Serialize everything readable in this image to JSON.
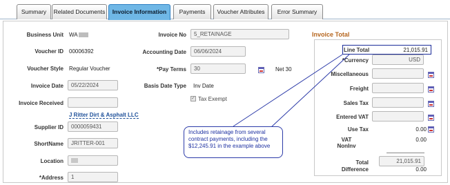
{
  "tabs": [
    {
      "label": "Summary",
      "active": false
    },
    {
      "label": "Related Documents",
      "active": false
    },
    {
      "label": "Invoice Information",
      "active": true
    },
    {
      "label": "Payments",
      "active": false
    },
    {
      "label": "Voucher Attributes",
      "active": false
    },
    {
      "label": "Error Summary",
      "active": false
    }
  ],
  "left": {
    "business_unit": {
      "label": "Business Unit",
      "value": "WA"
    },
    "voucher_id": {
      "label": "Voucher ID",
      "value": "00006392"
    },
    "voucher_style": {
      "label": "Voucher Style",
      "value": "Regular Voucher"
    },
    "invoice_date": {
      "label": "Invoice Date",
      "value": "05/22/2024"
    },
    "invoice_received": {
      "label": "Invoice Received",
      "value": ""
    },
    "supplier_name": "J Ritter Dirt & Asphalt LLC",
    "supplier_id": {
      "label": "Supplier ID",
      "value": "0000059431"
    },
    "short_name": {
      "label": "ShortName",
      "value": "JRITTER-001"
    },
    "location": {
      "label": "Location",
      "value": ""
    },
    "address": {
      "label": "*Address",
      "value": "1"
    }
  },
  "middle": {
    "invoice_no": {
      "label": "Invoice No",
      "value": "5_RETAINAGE"
    },
    "accounting_date": {
      "label": "Accounting Date",
      "value": "06/06/2024"
    },
    "pay_terms": {
      "label": "*Pay Terms",
      "value": "30",
      "description": "Net 30"
    },
    "basis_date_type": {
      "label": "Basis Date Type",
      "value": "Inv Date"
    },
    "tax_exempt": {
      "label": "Tax Exempt",
      "checked": true
    }
  },
  "invoice_total": {
    "title": "Invoice Total",
    "line_total": {
      "label": "Line Total",
      "value": "21,015.91"
    },
    "currency": {
      "label": "*Currency",
      "value": "USD"
    },
    "miscellaneous": {
      "label": "Miscellaneous",
      "value": ""
    },
    "freight": {
      "label": "Freight",
      "value": ""
    },
    "sales_tax": {
      "label": "Sales Tax",
      "value": ""
    },
    "entered_vat": {
      "label": "Entered VAT",
      "value": ""
    },
    "use_tax": {
      "label": "Use Tax",
      "value": "0.00"
    },
    "vat_noninv": {
      "label1": "VAT",
      "label2": "NonInv",
      "value": "0.00"
    },
    "total": {
      "label": "Total",
      "value": "21,015.91"
    },
    "difference": {
      "label": "Difference",
      "value": "0.00"
    }
  },
  "callout": {
    "text": "Includes retainage from several contract payments, including the $12,245.91 in the example above"
  },
  "colors": {
    "active_tab": "#6fb7e6",
    "section_title": "#b5651d",
    "link": "#1d4f99",
    "callout": "#1c2fa0"
  }
}
